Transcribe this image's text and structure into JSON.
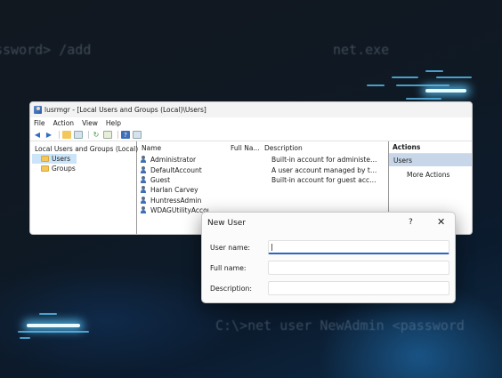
{
  "background": {
    "code_lines": [
      "ssword> /add",
      "net.exe",
      "C:\\>net user NewAdmin <password"
    ]
  },
  "window": {
    "title": "lusrmgr - [Local Users and Groups (Local)\\Users]",
    "menu": [
      "File",
      "Action",
      "View",
      "Help"
    ],
    "tree": {
      "root": "Local Users and Groups (Local)",
      "children": [
        "Users",
        "Groups"
      ]
    },
    "list": {
      "headers": [
        "Name",
        "Full Na...",
        "Description"
      ],
      "rows": [
        {
          "name": "Administrator",
          "full": "",
          "desc": "Built-in account for administering t..."
        },
        {
          "name": "DefaultAccount",
          "full": "",
          "desc": "A user account managed by the syst..."
        },
        {
          "name": "Guest",
          "full": "",
          "desc": "Built-in account for guest access to ..."
        },
        {
          "name": "Harlan Carvey",
          "full": "",
          "desc": ""
        },
        {
          "name": "HuntressAdmin",
          "full": "",
          "desc": ""
        },
        {
          "name": "WDAGUtilityAccou",
          "full": "",
          "desc": ""
        }
      ]
    },
    "actions": {
      "header": "Actions",
      "selected": "Users",
      "more": "More Actions"
    }
  },
  "dialog": {
    "title": "New User",
    "help": "?",
    "close": "✕",
    "fields": [
      {
        "label": "User name:",
        "value": "|"
      },
      {
        "label": "Full name:",
        "value": ""
      },
      {
        "label": "Description:",
        "value": ""
      }
    ]
  },
  "colors": {
    "accent": "#2a66c4",
    "selection": "#cce4f7",
    "action_selected": "#c7d6e8"
  }
}
